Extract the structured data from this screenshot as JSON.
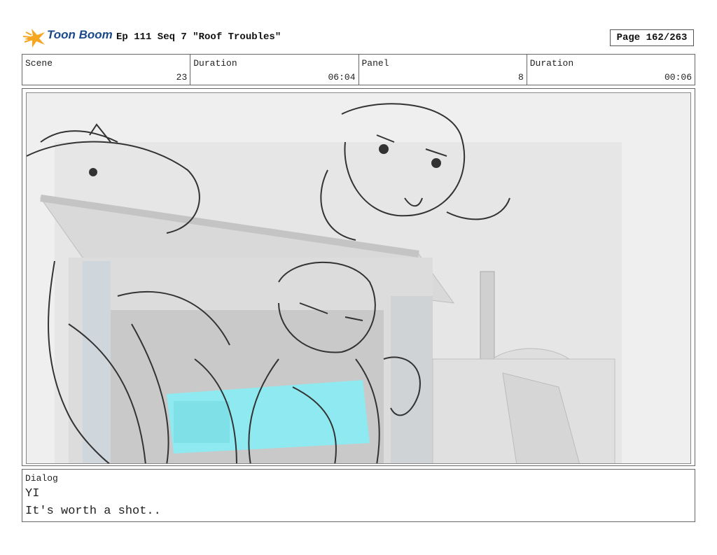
{
  "header": {
    "logo_text": "Toon Boom",
    "title": "Ep 111 Seq 7 \"Roof Troubles\"",
    "page": "Page 162/263"
  },
  "info": {
    "scene_label": "Scene",
    "scene_value": "23",
    "duration1_label": "Duration",
    "duration1_value": "06:04",
    "panel_label": "Panel",
    "panel_value": "8",
    "duration2_label": "Duration",
    "duration2_value": "00:06"
  },
  "dialog": {
    "label": "Dialog",
    "speaker": "YI",
    "line": "It's worth a shot.."
  },
  "colors": {
    "accent_cyan": "#8eeaf0",
    "logo_blue": "#1a4a8a",
    "logo_orange": "#f5a623"
  }
}
